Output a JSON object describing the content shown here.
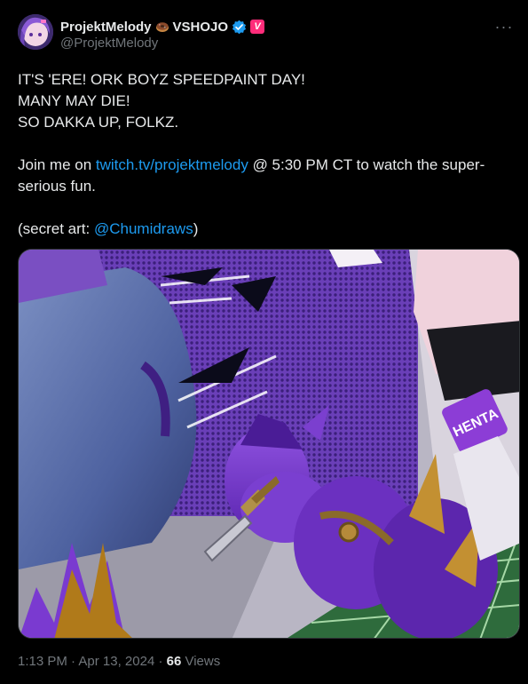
{
  "author": {
    "display_name": "ProjektMelody",
    "org_name": "VSHOJO",
    "handle": "@ProjektMelody",
    "name_emoji": "donut-icon",
    "verified_color": "#1d9bf0",
    "affiliate_badge_color": "#ff2c7a"
  },
  "more_icon": "···",
  "tweet": {
    "line1": "IT'S 'ERE! ORK BOYZ SPEEDPAINT DAY!",
    "line2": "MANY MAY DIE!",
    "line3": "SO DAKKA UP, FOLKZ.",
    "join_prefix": "Join me on ",
    "join_link": "twitch.tv/projektmelody",
    "join_suffix": " @ 5:30 PM CT to watch the super-serious fun.",
    "secret_prefix": "(secret art: ",
    "secret_link": "@Chumidraws",
    "secret_suffix": ")"
  },
  "media": {
    "armband_text": "HENTA"
  },
  "footer": {
    "time": "1:13 PM",
    "separator1": " · ",
    "date": "Apr 13, 2024",
    "separator2": " · ",
    "views_count": "66",
    "views_label": " Views"
  },
  "colors": {
    "link": "#1d9bf0",
    "text": "#e7e9ea",
    "muted": "#71767b",
    "background": "#000000"
  }
}
